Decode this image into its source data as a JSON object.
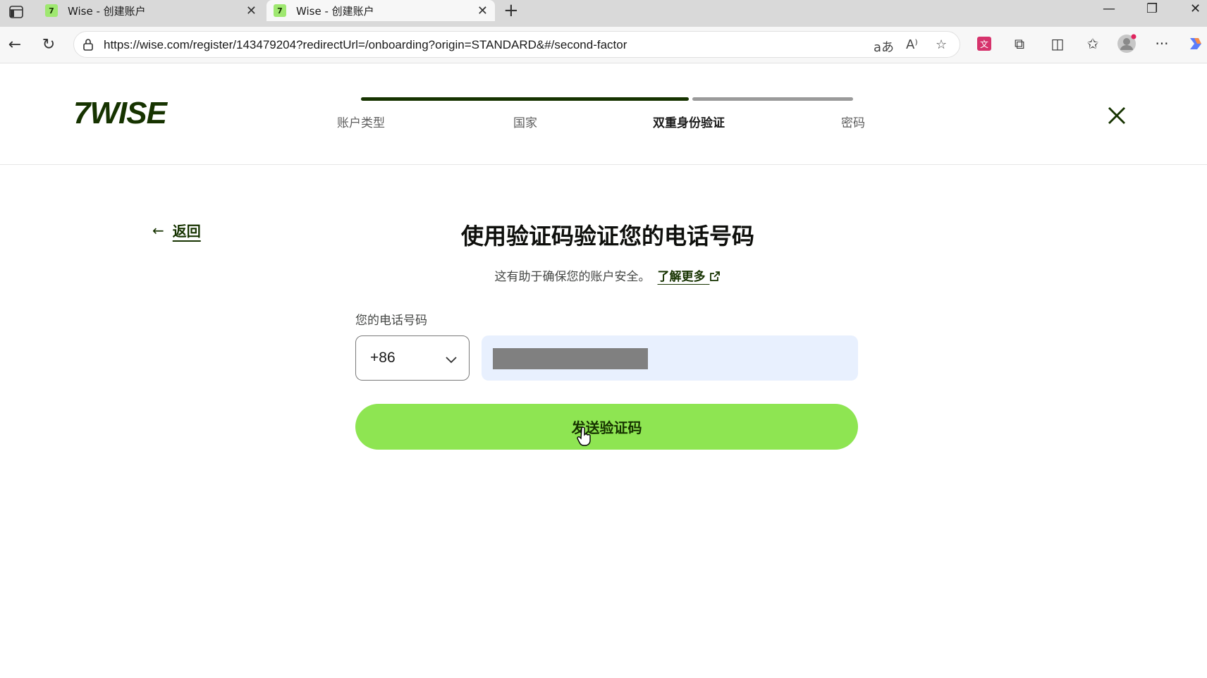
{
  "browser": {
    "tabs": [
      {
        "title": "Wise - 创建账户",
        "favicon": "wise-icon"
      },
      {
        "title": "Wise - 创建账户",
        "favicon": "wise-icon"
      }
    ],
    "url": "https://wise.com/register/143479204?redirectUrl=/onboarding?origin=STANDARD&#/second-factor"
  },
  "header": {
    "logo": "7WISE",
    "steps": [
      "账户类型",
      "国家",
      "双重身份验证",
      "密码"
    ],
    "active_step": 2,
    "progress": 0.73
  },
  "main": {
    "back_label": "返回",
    "title": "使用验证码验证您的电话号码",
    "subtitle": "这有助于确保您的账户安全。",
    "learn_more": "了解更多",
    "phone_label": "您的电话号码",
    "country_code": "+86",
    "send_button": "发送验证码"
  },
  "colors": {
    "brand_green": "#9fe870",
    "brand_dark": "#163300",
    "button_green": "#8ee552",
    "input_fill": "#e8f0fe"
  }
}
